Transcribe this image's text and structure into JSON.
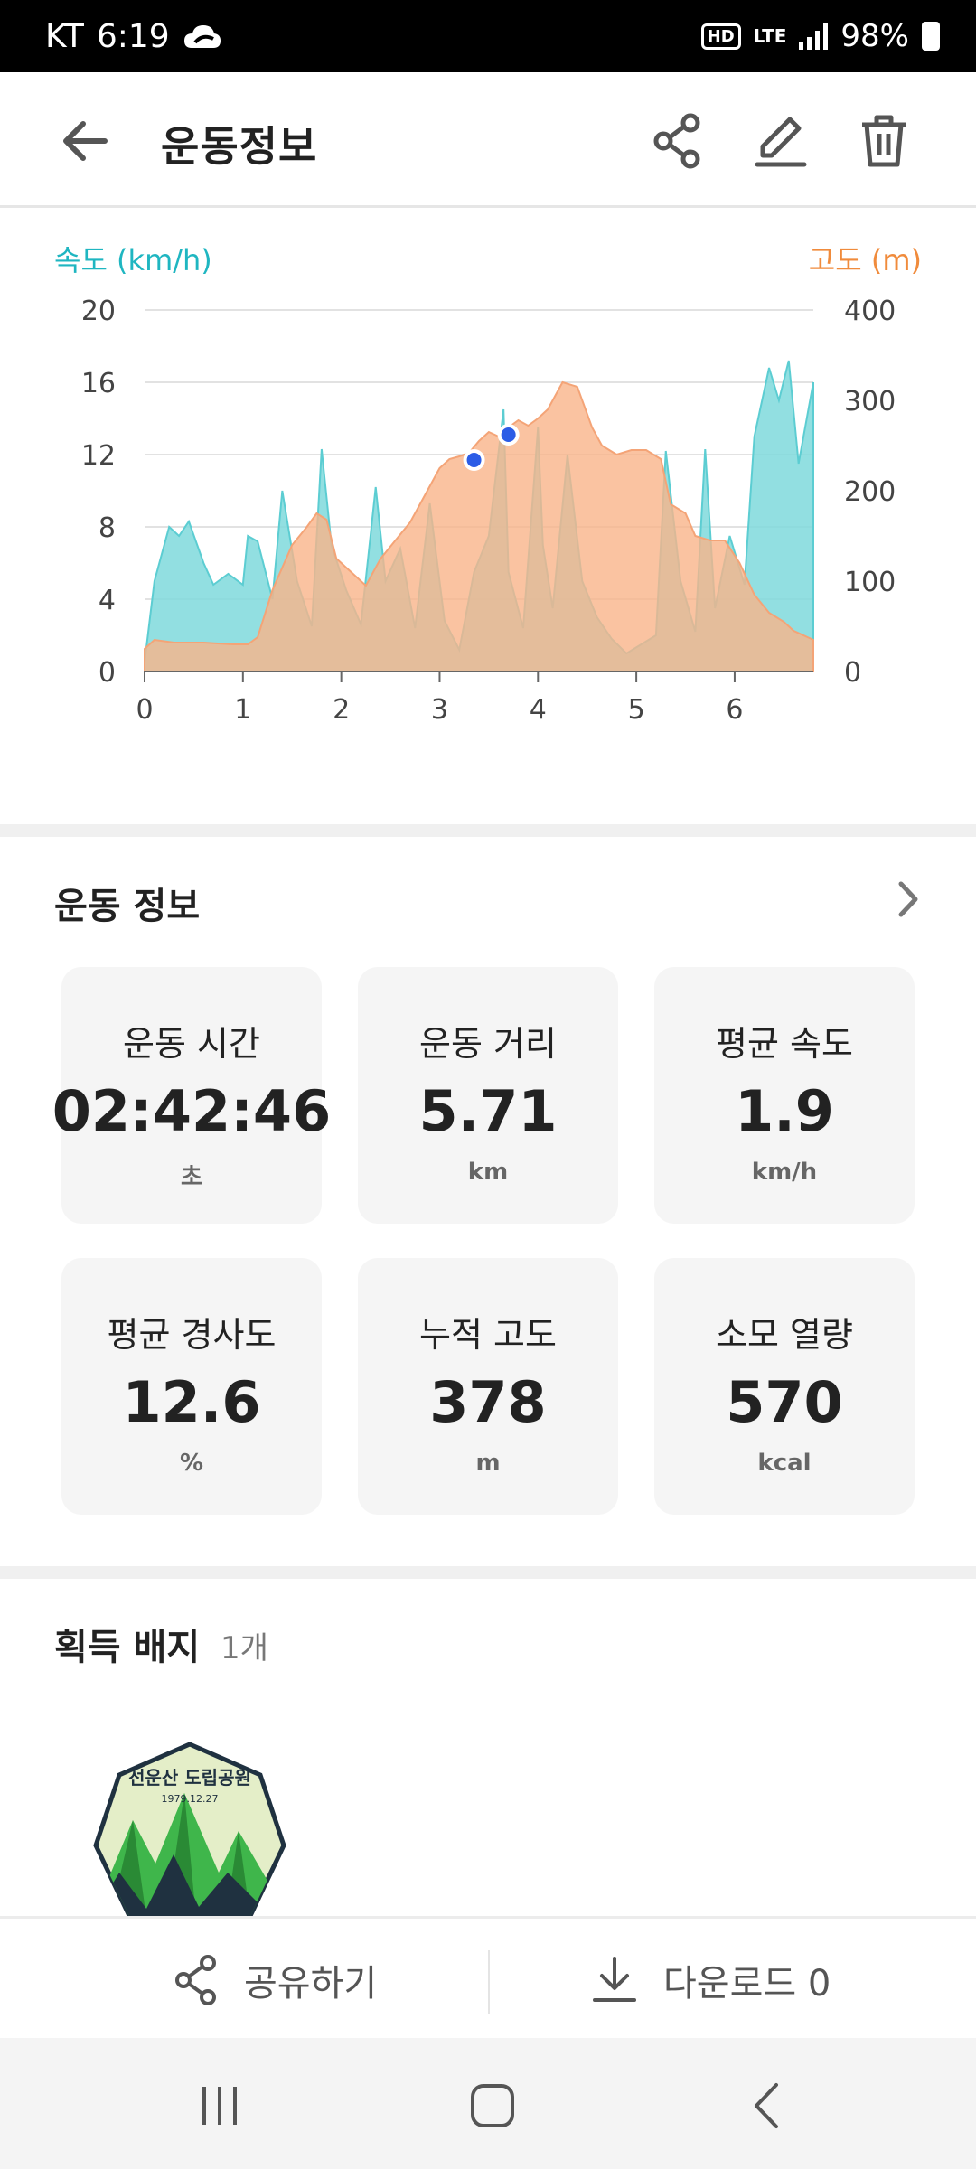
{
  "status_bar": {
    "carrier": "KT",
    "time": "6:19",
    "hd": "HD",
    "network": "LTE",
    "battery": "98%"
  },
  "app_bar": {
    "title": "운동정보",
    "icons": [
      "back-arrow-icon",
      "share-icon",
      "edit-pencil-icon",
      "trash-icon"
    ]
  },
  "chart_data": {
    "type": "area",
    "left_axis_label": "속도 (km/h)",
    "right_axis_label": "고도 (m)",
    "left_ylim": [
      0,
      20
    ],
    "right_ylim": [
      0,
      400
    ],
    "left_ticks": [
      "20",
      "16",
      "12",
      "8",
      "4",
      "0"
    ],
    "right_ticks": [
      "400",
      "300",
      "200",
      "100",
      "0"
    ],
    "x_ticks": [
      "0",
      "1",
      "2",
      "3",
      "4",
      "5",
      "6"
    ],
    "xlim": [
      0,
      6.8
    ],
    "grid": true,
    "colors": {
      "speed": "#7fd9dc",
      "altitude": "#f9b48a",
      "speed_title": "#1fb6c1",
      "altitude_title": "#f08b3c",
      "marker": "#2b5ce6"
    },
    "series": [
      {
        "name": "속도 (km/h)",
        "axis": "left",
        "x": [
          0,
          0.1,
          0.25,
          0.35,
          0.45,
          0.6,
          0.7,
          0.85,
          1.0,
          1.05,
          1.15,
          1.3,
          1.4,
          1.55,
          1.7,
          1.8,
          1.9,
          2.05,
          2.2,
          2.35,
          2.45,
          2.6,
          2.75,
          2.9,
          3.05,
          3.2,
          3.35,
          3.5,
          3.65,
          3.7,
          3.85,
          4.0,
          4.05,
          4.15,
          4.3,
          4.45,
          4.6,
          4.75,
          4.9,
          5.05,
          5.2,
          5.3,
          5.45,
          5.6,
          5.7,
          5.8,
          5.95,
          6.1,
          6.2,
          6.35,
          6.45,
          6.55,
          6.65,
          6.8
        ],
        "values": [
          0.5,
          5,
          8,
          7.5,
          8.3,
          6,
          4.8,
          5.4,
          4.8,
          7.5,
          7.2,
          4,
          10,
          5,
          2.5,
          12.3,
          7,
          4.5,
          2.6,
          10.2,
          5,
          6.8,
          2.4,
          9.3,
          2.8,
          1.2,
          5.5,
          7.5,
          14.5,
          5.5,
          2.4,
          13.5,
          7,
          3.5,
          12,
          5,
          3,
          1.8,
          1,
          1.5,
          2,
          12.2,
          5,
          2.2,
          12.3,
          3.5,
          7.5,
          4.8,
          13,
          16.8,
          15,
          17.2,
          11.5,
          16
        ]
      },
      {
        "name": "고도 (m)",
        "axis": "right",
        "x": [
          0,
          0.1,
          0.3,
          0.6,
          0.9,
          1.05,
          1.15,
          1.3,
          1.5,
          1.65,
          1.75,
          1.85,
          1.95,
          2.1,
          2.25,
          2.4,
          2.55,
          2.7,
          2.85,
          3.0,
          3.1,
          3.2,
          3.3,
          3.4,
          3.5,
          3.6,
          3.7,
          3.8,
          3.9,
          4.0,
          4.1,
          4.25,
          4.4,
          4.55,
          4.65,
          4.8,
          4.95,
          5.1,
          5.25,
          5.35,
          5.5,
          5.6,
          5.75,
          5.9,
          6.05,
          6.2,
          6.35,
          6.5,
          6.6,
          6.8
        ],
        "values": [
          25,
          35,
          32,
          32,
          30,
          30,
          38,
          90,
          140,
          160,
          175,
          168,
          125,
          110,
          95,
          125,
          145,
          165,
          195,
          225,
          235,
          238,
          242,
          255,
          265,
          260,
          270,
          278,
          272,
          280,
          290,
          320,
          315,
          270,
          250,
          240,
          245,
          245,
          235,
          185,
          175,
          150,
          145,
          145,
          120,
          85,
          65,
          55,
          45,
          35
        ]
      }
    ],
    "markers": [
      {
        "x": 3.35,
        "y": 11.7,
        "axis": "left"
      },
      {
        "x": 3.7,
        "y": 13.1,
        "axis": "left"
      }
    ]
  },
  "workout_info": {
    "title": "운동 정보",
    "cards": [
      {
        "label": "운동 시간",
        "value": "02:42:46",
        "unit": "초"
      },
      {
        "label": "운동 거리",
        "value": "5.71",
        "unit": "km"
      },
      {
        "label": "평균 속도",
        "value": "1.9",
        "unit": "km/h"
      },
      {
        "label": "평균 경사도",
        "value": "12.6",
        "unit": "%"
      },
      {
        "label": "누적 고도",
        "value": "378",
        "unit": "m"
      },
      {
        "label": "소모 열량",
        "value": "570",
        "unit": "kcal"
      }
    ]
  },
  "badges": {
    "title": "획득 배지",
    "count": "1개",
    "badge_text": "선운산 도립공원",
    "badge_date": "1979.12.27"
  },
  "actions": {
    "share_label": "공유하기",
    "download_label": "다운로드 0"
  }
}
